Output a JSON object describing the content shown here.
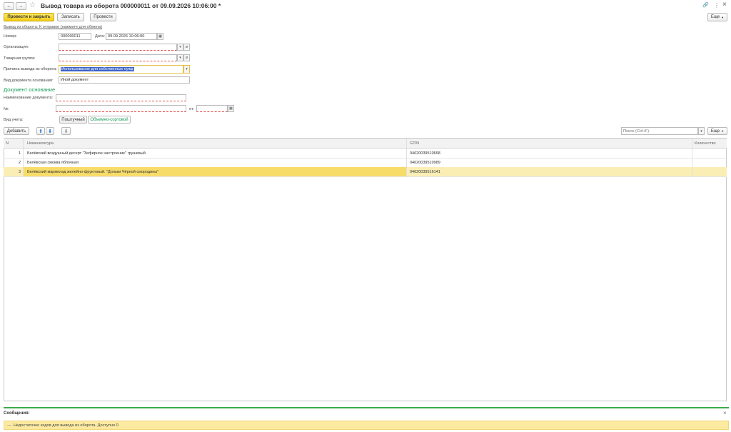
{
  "window": {
    "title": "Вывод товара из оборота 000000011 от 09.09.2026 10:06:00 *",
    "nav_back": "←",
    "nav_forward": "→",
    "star": "☆",
    "link_icon": "🔗",
    "more_icon": "⋮",
    "close_icon": "×"
  },
  "toolbar": {
    "post_close_label": "Провести и закрыть",
    "save_label": "Записать",
    "post_label": "Провести",
    "more_label": "Еще"
  },
  "status_link": "Вывод из оборота: К отправке (нажмите для обмена)",
  "form": {
    "number_label": "Номер:",
    "number_value": "000000011",
    "date_label": "Дата:",
    "date_value": "09.09.2026 10:06:00",
    "org_label": "Организация:",
    "org_value": "",
    "group_label": "Товарная группа:",
    "group_value": "",
    "reason_label": "Причина вывода из оборота:",
    "reason_value": "Использование для собственных нужд",
    "doc_type_label": "Вид документа основания:",
    "doc_type_value": "Иной документ",
    "section_title": "Документ основание",
    "doc_name_label": "Наименование документа:",
    "doc_name_value": "",
    "doc_num_label": "№:",
    "doc_num_value": "",
    "doc_date_label": "от:",
    "doc_date_value": "  .  .    ",
    "account_label": "Вид учета:",
    "account_options": [
      "Поштучный",
      "Объемно-сортовой"
    ]
  },
  "table_toolbar": {
    "add_label": "Добавить",
    "search_placeholder": "Поиск (Ctrl+F)",
    "more_label": "Еще"
  },
  "table": {
    "columns": [
      "N",
      "Номенклатура",
      "GTIN",
      "Количество"
    ],
    "rows": [
      {
        "n": "1",
        "name": "Белёвский воздушный десерт \"Зефирное настроение\" грушевый",
        "gtin": "04620039510668",
        "qty": ""
      },
      {
        "n": "2",
        "name": "Белёвская смоква яблочная",
        "gtin": "04620039510989",
        "qty": ""
      },
      {
        "n": "3",
        "name": "Белёвский мармелад желейно-фруктовый. \"Дольки Чёрной смородины\"",
        "gtin": "04620039516141",
        "qty": ""
      }
    ]
  },
  "messages": {
    "title": "Сообщения:",
    "text": "Недостаточно кодов для вывода из оборота. Доступно 0"
  },
  "colors": {
    "accent": "#f3cc17",
    "selected_row": "#fbeeb5",
    "message_bg": "#fbeaa0",
    "message_bar": "#3aab4a",
    "section_title": "#1a9e5a"
  }
}
